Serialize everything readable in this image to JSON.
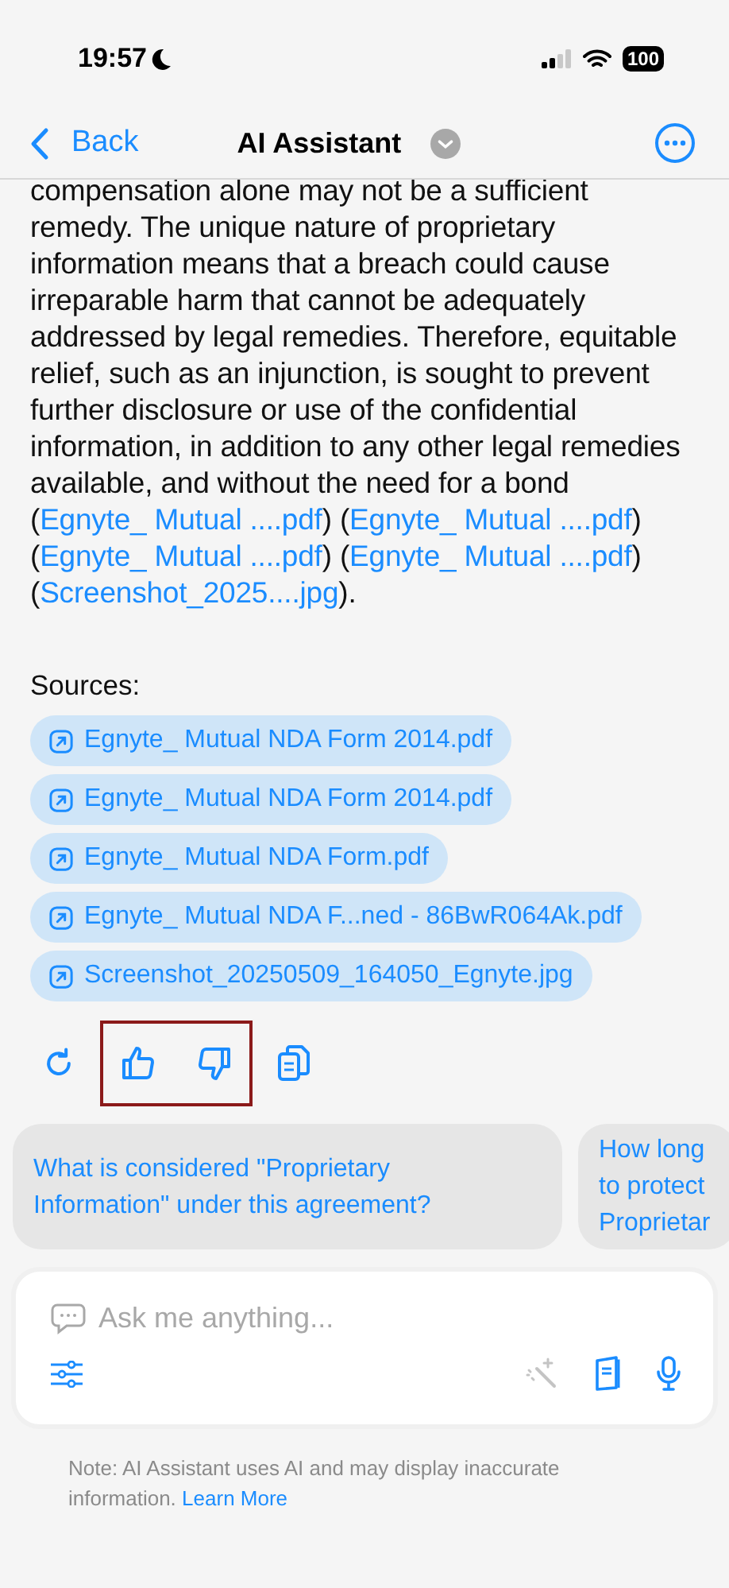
{
  "status_bar": {
    "time": "19:57",
    "battery": "100"
  },
  "nav": {
    "back": "Back",
    "title": "AI Assistant"
  },
  "answer": [
    {
      "kind": "text",
      "text": "compensation alone may not be a sufficient remedy. The unique nature of proprietary information means that a breach could cause irreparable harm that cannot be adequately addressed by legal remedies. Therefore, equitable relief, such as an injunction, is sought to prevent further disclosure or use of the confidential information, in addition to any other legal remedies available, and without the need for a bond ("
    },
    {
      "kind": "link",
      "text": "Egnyte_ Mutual ....pdf"
    },
    {
      "kind": "text",
      "text": ") ("
    },
    {
      "kind": "link",
      "text": "Egnyte_ Mutual ....pdf"
    },
    {
      "kind": "text",
      "text": ") ("
    },
    {
      "kind": "link",
      "text": "Egnyte_ Mutual ....pdf"
    },
    {
      "kind": "text",
      "text": ") ("
    },
    {
      "kind": "link",
      "text": "Egnyte_ Mutual ....pdf"
    },
    {
      "kind": "text",
      "text": ") ("
    },
    {
      "kind": "link",
      "text": "Screenshot_2025....jpg"
    },
    {
      "kind": "text",
      "text": ")."
    }
  ],
  "sources_label": "Sources:",
  "sources": [
    "Egnyte_ Mutual NDA Form 2014.pdf",
    "Egnyte_ Mutual NDA Form 2014.pdf",
    "Egnyte_ Mutual NDA Form.pdf",
    "Egnyte_ Mutual NDA F...ned - 86BwR064Ak.pdf",
    "Screenshot_20250509_164050_Egnyte.jpg"
  ],
  "feedback_highlighted": true,
  "suggestions": [
    "What is considered \"Proprietary Information\" under this agreement?",
    "How long to protect Proprietar"
  ],
  "input": {
    "placeholder": "Ask me anything..."
  },
  "note": {
    "text": "Note: AI Assistant uses AI and may display inaccurate information.",
    "link": "Learn More"
  }
}
